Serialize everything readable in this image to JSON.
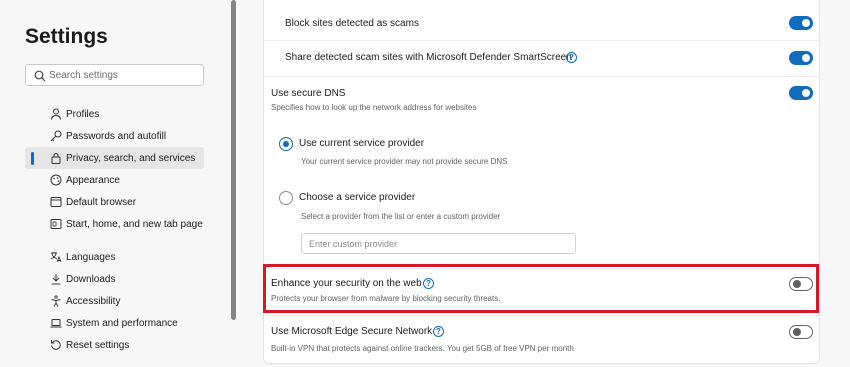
{
  "sidebar": {
    "title": "Settings",
    "search_placeholder": "Search settings",
    "items": [
      {
        "label": "Profiles",
        "icon": "person-icon"
      },
      {
        "label": "Passwords and autofill",
        "icon": "key-icon"
      },
      {
        "label": "Privacy, search, and services",
        "icon": "lock-icon",
        "active": true
      },
      {
        "label": "Appearance",
        "icon": "palette-icon"
      },
      {
        "label": "Default browser",
        "icon": "browser-icon"
      },
      {
        "label": "Start, home, and new tab page",
        "icon": "home-icon"
      },
      {
        "label": "Languages",
        "icon": "language-icon"
      },
      {
        "label": "Downloads",
        "icon": "download-icon"
      },
      {
        "label": "Accessibility",
        "icon": "accessibility-icon"
      },
      {
        "label": "System and performance",
        "icon": "laptop-icon"
      },
      {
        "label": "Reset settings",
        "icon": "reset-icon"
      }
    ]
  },
  "main": {
    "block_scams": {
      "label": "Block sites detected as scams",
      "enabled": true
    },
    "share_scams": {
      "label": "Share detected scam sites with Microsoft Defender SmartScreen",
      "enabled": true
    },
    "secure_dns": {
      "label": "Use secure DNS",
      "description": "Specifies how to look up the network address for websites",
      "enabled": true
    },
    "current_provider": {
      "label": "Use current service provider",
      "description": "Your current service provider may not provide secure DNS",
      "selected": true
    },
    "choose_provider": {
      "label": "Choose a service provider",
      "description": "Select a provider from the list or enter a custom provider",
      "selected": false,
      "input_placeholder": "Enter custom provider"
    },
    "enhance_security": {
      "label": "Enhance your security on the web",
      "description": "Protects your browser from malware by blocking security threats.",
      "enabled": false
    },
    "secure_network": {
      "label": "Use Microsoft Edge Secure Network",
      "description": "Built-in VPN that protects against online trackers. You get 5GB of free VPN per month",
      "enabled": false
    }
  },
  "colors": {
    "accent": "#0f6cbd",
    "highlight": "#d7182a"
  }
}
